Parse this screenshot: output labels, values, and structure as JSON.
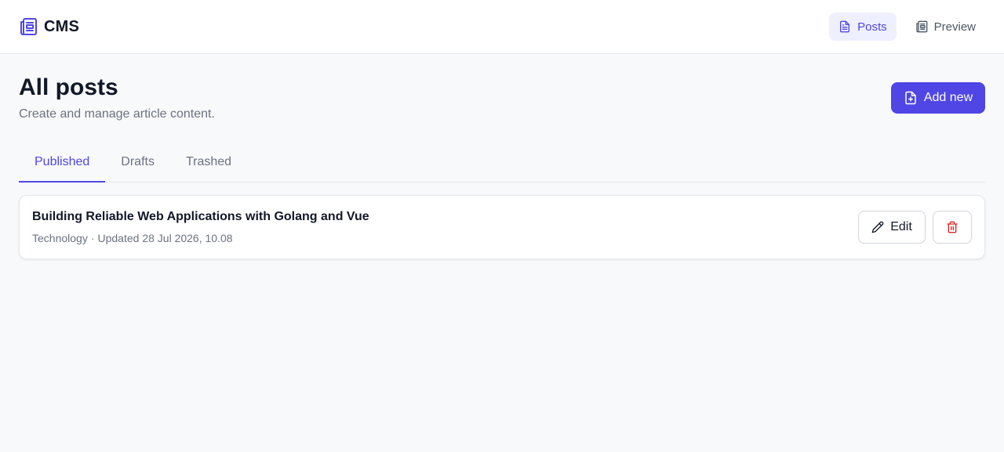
{
  "app": {
    "brand": "CMS",
    "brand_icon": "newspaper-icon"
  },
  "nav": {
    "items": [
      {
        "label": "Posts",
        "icon": "document-icon",
        "active": true
      },
      {
        "label": "Preview",
        "icon": "newspaper-icon",
        "active": false
      }
    ]
  },
  "page": {
    "title": "All posts",
    "subtitle": "Create and manage article content.",
    "add_button_label": "Add new",
    "add_button_icon": "file-plus-icon"
  },
  "tabs": [
    {
      "label": "Published",
      "active": true
    },
    {
      "label": "Drafts",
      "active": false
    },
    {
      "label": "Trashed",
      "active": false
    }
  ],
  "posts": [
    {
      "title": "Building Reliable Web Applications with Golang and Vue",
      "category": "Technology",
      "separator": "·",
      "updated": "Updated 28 Jul 2026, 10.08",
      "edit_label": "Edit",
      "edit_icon": "pencil-icon",
      "delete_icon": "trash-icon"
    }
  ],
  "colors": {
    "accent": "#4f46e5",
    "accent_soft": "#eef0ff",
    "danger": "#dc2626",
    "background": "#f8f9fb"
  }
}
